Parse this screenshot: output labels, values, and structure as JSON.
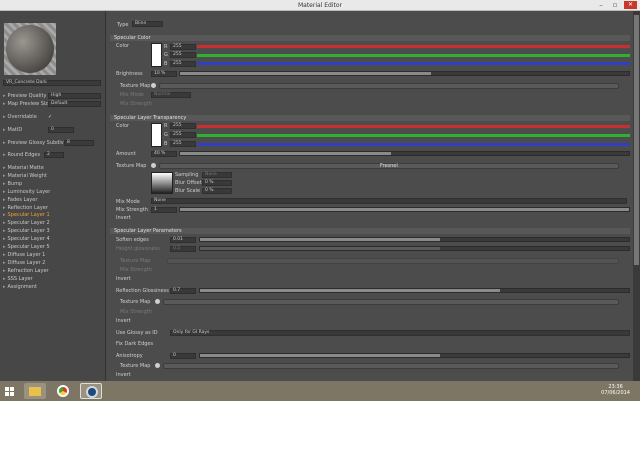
{
  "window": {
    "title": "Material Editor"
  },
  "left": {
    "material_name": "VR_Concrete Dark",
    "rows": [
      {
        "label": "Preview Quality",
        "value": "High"
      },
      {
        "label": "Map Preview Size",
        "value": "Default"
      },
      {
        "label": "Overridable",
        "value": "✓"
      },
      {
        "label": "MatID",
        "value": "0"
      },
      {
        "label": "Preview Glossy Subdivs",
        "value": "8"
      },
      {
        "label": "Round Edges",
        "value": "2"
      }
    ],
    "layers": [
      "Material Matte",
      "Material Weight",
      "Bump",
      "Luminosity Layer",
      "Fades Layer",
      "Reflection Layer",
      "Specular Layer 1",
      "Specular Layer 2",
      "Specular Layer 3",
      "Specular Layer 4",
      "Specular Layer 5",
      "Diffuse Layer 1",
      "Diffuse Layer 2",
      "Refraction Layer",
      "SSS Layer",
      "Assignment"
    ],
    "selected": "Specular Layer 1"
  },
  "main": {
    "type_label": "Type",
    "type_value": "Blinn",
    "s1": "Specular Color",
    "color_label": "Color",
    "r_label": "R",
    "g_label": "G",
    "b_label": "B",
    "c1_r": "255",
    "c1_g": "255",
    "c1_b": "255",
    "brightness_label": "Brightness",
    "brightness_value": "10 %",
    "texture_map": "Texture Map",
    "mix_mode": "Mix Mode",
    "mix_mode_value": "Normal",
    "mix_strength": "Mix Strength",
    "s2": "Specular Layer Transparency",
    "c2_r": "255",
    "c2_g": "255",
    "c2_b": "255",
    "amount_label": "Amount",
    "amount_value": "40 %",
    "fresnel": "Fresnel",
    "sampling": "Sampling",
    "sampling_value": "None",
    "blur_offset": "Blur Offset",
    "blur_offset_value": "0 %",
    "blur_scale": "Blur Scale",
    "blur_scale_value": "0 %",
    "mix_mode_value2": "None",
    "mix_strength_value": "1",
    "invert": "Invert",
    "s3": "Specular Layer Parameters",
    "soften_edges": "Soften edges",
    "soften_value": "0.01",
    "height_glossiness": "Height glossiness",
    "height_value": "0.5",
    "refl_gloss": "Reflection Glossiness",
    "refl_value": "0.7",
    "use_glossy": "Use Glossy as ID",
    "use_glossy_value": "Only for GI Rays",
    "fix_dark": "Fix Dark Edges",
    "anisotropy": "Anisotropy",
    "aniso_value": "0"
  },
  "taskbar": {
    "time": "23:36",
    "date": "07/06/2014"
  },
  "colors": {
    "red": "#c83030",
    "green": "#30b030",
    "blue": "#3040c0",
    "accent": "#e0a030"
  },
  "progress": {
    "brightness": 0.56,
    "amount": 0.47,
    "soften": 0.56,
    "height": 0.56,
    "refl": 0.7,
    "aniso": 0.56
  }
}
